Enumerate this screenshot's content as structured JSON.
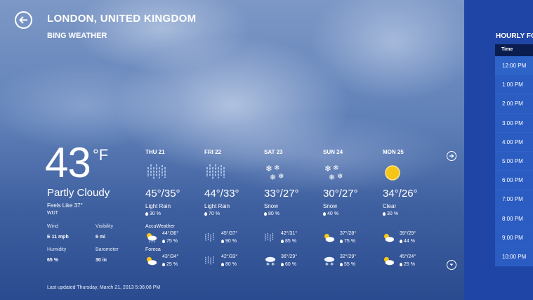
{
  "header": {
    "city": "LONDON, UNITED KINGDOM",
    "app_name": "BING WEATHER"
  },
  "current": {
    "temp": "43",
    "unit": "°F",
    "condition": "Partly Cloudy",
    "feels_like": "Feels Like 37°",
    "station": "WDT",
    "details": {
      "wind_label": "Wind",
      "wind_value": "E 11 mph",
      "visibility_label": "Visibility",
      "visibility_value": "6 mi",
      "humidity_label": "Humidity",
      "humidity_value": "65 %",
      "barometer_label": "Barometer",
      "barometer_value": "30 in"
    }
  },
  "providers": [
    "AccuWeather",
    "Foreca"
  ],
  "forecast": [
    {
      "day": "THU 21",
      "temp": "45°/35°",
      "cond": "Light Rain",
      "precip": "30 %",
      "icon": "rain-icon",
      "accu": {
        "temp": "44°/36°",
        "precip": "75 %",
        "icon": "partly-cloudy-rain-icon"
      },
      "foreca": {
        "temp": "43°/34°",
        "precip": "25 %",
        "icon": "partly-cloudy-icon"
      }
    },
    {
      "day": "FRI 22",
      "temp": "44°/33°",
      "cond": "Light Rain",
      "precip": "70 %",
      "icon": "rain-icon",
      "accu": {
        "temp": "45°/37°",
        "precip": "90 %",
        "icon": "rain-icon"
      },
      "foreca": {
        "temp": "42°/33°",
        "precip": "80 %",
        "icon": "rain-icon"
      }
    },
    {
      "day": "SAT 23",
      "temp": "33°/27°",
      "cond": "Snow",
      "precip": "80 %",
      "icon": "snow-icon",
      "accu": {
        "temp": "42°/31°",
        "precip": "85 %",
        "icon": "rain-icon"
      },
      "foreca": {
        "temp": "36°/29°",
        "precip": "60 %",
        "icon": "cloud-snow-icon"
      }
    },
    {
      "day": "SUN 24",
      "temp": "30°/27°",
      "cond": "Snow",
      "precip": "40 %",
      "icon": "snow-icon",
      "accu": {
        "temp": "37°/28°",
        "precip": "75 %",
        "icon": "partly-cloudy-icon"
      },
      "foreca": {
        "temp": "32°/29°",
        "precip": "55 %",
        "icon": "cloud-snow-icon"
      }
    },
    {
      "day": "MON 25",
      "temp": "34°/26°",
      "cond": "Clear",
      "precip": "30 %",
      "icon": "sun-icon",
      "accu": {
        "temp": "39°/29°",
        "precip": "44 %",
        "icon": "partly-cloudy-icon"
      },
      "foreca": {
        "temp": "45°/24°",
        "precip": "25 %",
        "icon": "partly-cloudy-icon"
      }
    }
  ],
  "last_updated": "Last updated Thursday, March 21, 2013 5:36:08 PM",
  "hourly": {
    "title": "HOURLY FO",
    "column_header": "Time",
    "times": [
      "12:00 PM",
      "1:00 PM",
      "2:00 PM",
      "3:00 PM",
      "4:00 PM",
      "5:00 PM",
      "6:00 PM",
      "7:00 PM",
      "8:00 PM",
      "9:00 PM",
      "10:00 PM"
    ]
  },
  "colors": {
    "hourly_panel": "#1f45a6",
    "hourly_header": "#0b1d4f",
    "sun": "#f5c518"
  }
}
